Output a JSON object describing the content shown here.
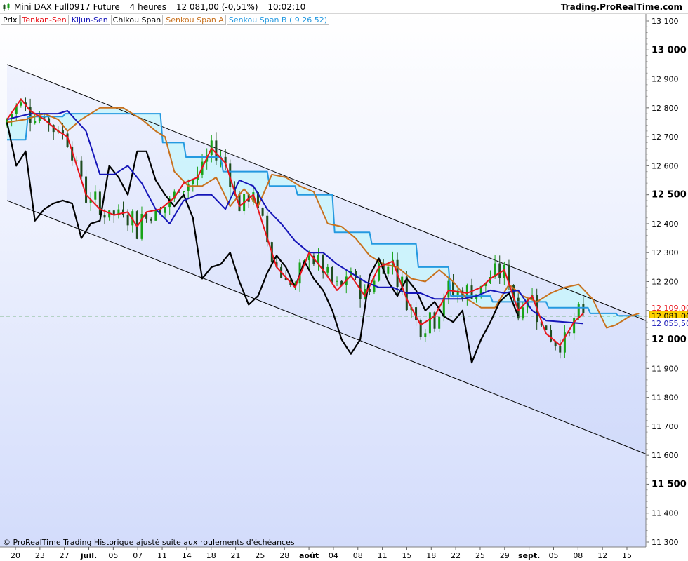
{
  "header": {
    "instrument": "Mini DAX Full0917 Future",
    "timeframe": "4 heures",
    "last_price": "12 081,00 (-0,51%)",
    "time": "10:02:10",
    "brand": "Trading.ProRealTime.com"
  },
  "legend": [
    {
      "label": "Prix",
      "color": "#000000"
    },
    {
      "label": "Tenkan-Sen",
      "color": "#e8141b"
    },
    {
      "label": "Kijun-Sen",
      "color": "#1515b8"
    },
    {
      "label": "Chikou Span",
      "color": "#000000"
    },
    {
      "label": "Senkou Span A",
      "color": "#c8711e"
    },
    {
      "label": "Senkou Span B ( 9 26 52)",
      "color": "#2499e0"
    }
  ],
  "footer": {
    "copyright": "© ProRealTime Trading  Historique ajusté suite aux roulements d'échéances"
  },
  "chart_data": {
    "type": "line",
    "ylim": [
      11300,
      13100
    ],
    "y_ticks": [
      "13 100",
      "13 000",
      "12 900",
      "12 800",
      "12 700",
      "12 600",
      "12 500",
      "12 400",
      "12 300",
      "12 200",
      "12 100",
      "12 000",
      "11 900",
      "11 800",
      "11 700",
      "11 600",
      "11 500",
      "11 400",
      "11 300"
    ],
    "y_major_ticks": [
      "13 000",
      "12 500",
      "12 000",
      "11 500"
    ],
    "x_ticks": [
      "20",
      "23",
      "27",
      "juil.",
      "05",
      "07",
      "11",
      "14",
      "18",
      "21",
      "25",
      "28",
      "août",
      "04",
      "08",
      "11",
      "15",
      "18",
      "22",
      "25",
      "29",
      "sept.",
      "05",
      "08",
      "12",
      "15"
    ],
    "x_major_ticks": [
      "juil.",
      "août",
      "sept."
    ],
    "price_labels": [
      {
        "label": "12 109,00",
        "value": 12109,
        "color": "#e8141b"
      },
      {
        "label": "12 081,00",
        "value": 12081,
        "color": "#000000"
      },
      {
        "label": "12 055,50",
        "value": 12055.5,
        "color": "#1515b8"
      }
    ],
    "current_price": 12081,
    "colors": {
      "candle_up": "#17a317",
      "candle_down": "#1f4d1f",
      "tenkan": "#e8141b",
      "kijun": "#1515b8",
      "chikou": "#000000",
      "span_a": "#c8711e",
      "span_b": "#2499e0",
      "cloud": "#c9f4fb",
      "current_price_line": "#1f8a1f",
      "channel_fill": "#e8edfd"
    },
    "channel": {
      "upper": [
        [
          0,
          12950
        ],
        [
          146,
          12010
        ]
      ],
      "lower": [
        [
          0,
          12480
        ],
        [
          146,
          11550
        ]
      ]
    },
    "series": [
      {
        "name": "Tenkan-Sen",
        "key": "tenkan",
        "points": [
          [
            0,
            12760
          ],
          [
            3,
            12830
          ],
          [
            5,
            12790
          ],
          [
            8,
            12760
          ],
          [
            11,
            12720
          ],
          [
            13,
            12700
          ],
          [
            17,
            12500
          ],
          [
            20,
            12450
          ],
          [
            23,
            12430
          ],
          [
            26,
            12440
          ],
          [
            28,
            12390
          ],
          [
            30,
            12440
          ],
          [
            33,
            12450
          ],
          [
            36,
            12490
          ],
          [
            38,
            12540
          ],
          [
            41,
            12560
          ],
          [
            44,
            12660
          ],
          [
            47,
            12610
          ],
          [
            50,
            12460
          ],
          [
            53,
            12500
          ],
          [
            55,
            12400
          ],
          [
            58,
            12250
          ],
          [
            62,
            12180
          ],
          [
            65,
            12300
          ],
          [
            68,
            12240
          ],
          [
            71,
            12170
          ],
          [
            74,
            12220
          ],
          [
            77,
            12150
          ],
          [
            80,
            12250
          ],
          [
            83,
            12270
          ],
          [
            86,
            12140
          ],
          [
            89,
            12050
          ],
          [
            92,
            12080
          ],
          [
            95,
            12170
          ],
          [
            99,
            12160
          ],
          [
            102,
            12180
          ],
          [
            104,
            12210
          ],
          [
            107,
            12240
          ],
          [
            110,
            12100
          ],
          [
            113,
            12150
          ],
          [
            116,
            12020
          ],
          [
            119,
            11980
          ],
          [
            122,
            12060
          ],
          [
            124,
            12090
          ]
        ]
      },
      {
        "name": "Kijun-Sen",
        "key": "kijun",
        "points": [
          [
            0,
            12760
          ],
          [
            5,
            12780
          ],
          [
            11,
            12780
          ],
          [
            13,
            12790
          ],
          [
            17,
            12720
          ],
          [
            20,
            12570
          ],
          [
            23,
            12570
          ],
          [
            26,
            12600
          ],
          [
            29,
            12540
          ],
          [
            32,
            12450
          ],
          [
            35,
            12400
          ],
          [
            38,
            12480
          ],
          [
            41,
            12500
          ],
          [
            44,
            12500
          ],
          [
            47,
            12450
          ],
          [
            50,
            12550
          ],
          [
            53,
            12530
          ],
          [
            56,
            12450
          ],
          [
            59,
            12400
          ],
          [
            62,
            12340
          ],
          [
            65,
            12300
          ],
          [
            68,
            12300
          ],
          [
            71,
            12260
          ],
          [
            74,
            12230
          ],
          [
            77,
            12200
          ],
          [
            80,
            12180
          ],
          [
            83,
            12180
          ],
          [
            86,
            12160
          ],
          [
            89,
            12160
          ],
          [
            92,
            12140
          ],
          [
            95,
            12140
          ],
          [
            98,
            12140
          ],
          [
            101,
            12150
          ],
          [
            104,
            12170
          ],
          [
            107,
            12160
          ],
          [
            110,
            12170
          ],
          [
            113,
            12100
          ],
          [
            116,
            12065
          ],
          [
            120,
            12060
          ],
          [
            124,
            12055
          ]
        ]
      },
      {
        "name": "Chikou Span",
        "key": "chikou",
        "points": [
          [
            0,
            12750
          ],
          [
            2,
            12600
          ],
          [
            4,
            12650
          ],
          [
            6,
            12410
          ],
          [
            8,
            12450
          ],
          [
            10,
            12470
          ],
          [
            12,
            12480
          ],
          [
            14,
            12470
          ],
          [
            16,
            12350
          ],
          [
            18,
            12400
          ],
          [
            20,
            12410
          ],
          [
            22,
            12600
          ],
          [
            24,
            12560
          ],
          [
            26,
            12500
          ],
          [
            28,
            12650
          ],
          [
            30,
            12650
          ],
          [
            32,
            12550
          ],
          [
            34,
            12500
          ],
          [
            36,
            12460
          ],
          [
            38,
            12500
          ],
          [
            40,
            12420
          ],
          [
            42,
            12210
          ],
          [
            44,
            12250
          ],
          [
            46,
            12260
          ],
          [
            48,
            12300
          ],
          [
            50,
            12200
          ],
          [
            52,
            12120
          ],
          [
            54,
            12150
          ],
          [
            56,
            12230
          ],
          [
            58,
            12290
          ],
          [
            60,
            12250
          ],
          [
            62,
            12180
          ],
          [
            64,
            12270
          ],
          [
            66,
            12210
          ],
          [
            68,
            12170
          ],
          [
            70,
            12100
          ],
          [
            72,
            12000
          ],
          [
            74,
            11950
          ],
          [
            76,
            12000
          ],
          [
            78,
            12220
          ],
          [
            80,
            12280
          ],
          [
            82,
            12200
          ],
          [
            84,
            12150
          ],
          [
            86,
            12210
          ],
          [
            88,
            12170
          ],
          [
            90,
            12100
          ],
          [
            92,
            12130
          ],
          [
            94,
            12080
          ],
          [
            96,
            12060
          ],
          [
            98,
            12100
          ],
          [
            100,
            11920
          ],
          [
            102,
            12000
          ],
          [
            104,
            12060
          ],
          [
            106,
            12130
          ],
          [
            108,
            12160
          ],
          [
            110,
            12080
          ]
        ]
      },
      {
        "name": "Senkou Span A",
        "key": "span_a",
        "points": [
          [
            0,
            12750
          ],
          [
            4,
            12760
          ],
          [
            8,
            12780
          ],
          [
            11,
            12760
          ],
          [
            13,
            12720
          ],
          [
            16,
            12760
          ],
          [
            20,
            12800
          ],
          [
            25,
            12800
          ],
          [
            29,
            12760
          ],
          [
            32,
            12720
          ],
          [
            34,
            12700
          ],
          [
            36,
            12580
          ],
          [
            39,
            12530
          ],
          [
            42,
            12530
          ],
          [
            45,
            12560
          ],
          [
            48,
            12460
          ],
          [
            51,
            12520
          ],
          [
            54,
            12460
          ],
          [
            57,
            12570
          ],
          [
            60,
            12560
          ],
          [
            63,
            12530
          ],
          [
            66,
            12510
          ],
          [
            69,
            12400
          ],
          [
            72,
            12390
          ],
          [
            75,
            12350
          ],
          [
            78,
            12290
          ],
          [
            81,
            12260
          ],
          [
            84,
            12250
          ],
          [
            87,
            12210
          ],
          [
            90,
            12200
          ],
          [
            93,
            12240
          ],
          [
            96,
            12200
          ],
          [
            99,
            12140
          ],
          [
            102,
            12110
          ],
          [
            105,
            12110
          ],
          [
            108,
            12190
          ],
          [
            111,
            12150
          ],
          [
            114,
            12130
          ],
          [
            117,
            12160
          ],
          [
            120,
            12180
          ],
          [
            123,
            12190
          ],
          [
            126,
            12140
          ],
          [
            129,
            12040
          ],
          [
            131,
            12050
          ],
          [
            134,
            12080
          ],
          [
            136,
            12090
          ]
        ]
      },
      {
        "name": "Senkou Span B ( 9 26 52)",
        "key": "span_b",
        "points": [
          [
            0,
            12690
          ],
          [
            4,
            12690
          ],
          [
            4.5,
            12770
          ],
          [
            12,
            12770
          ],
          [
            12.5,
            12780
          ],
          [
            20,
            12780
          ],
          [
            20.5,
            12780
          ],
          [
            33,
            12780
          ],
          [
            33.5,
            12680
          ],
          [
            38,
            12680
          ],
          [
            38.5,
            12630
          ],
          [
            46,
            12630
          ],
          [
            46.5,
            12580
          ],
          [
            56,
            12580
          ],
          [
            56.5,
            12530
          ],
          [
            62,
            12530
          ],
          [
            62.5,
            12500
          ],
          [
            70,
            12500
          ],
          [
            70.5,
            12370
          ],
          [
            78,
            12370
          ],
          [
            78.5,
            12330
          ],
          [
            88,
            12330
          ],
          [
            88.5,
            12250
          ],
          [
            95,
            12250
          ],
          [
            95.5,
            12150
          ],
          [
            104,
            12150
          ],
          [
            104.5,
            12130
          ],
          [
            116,
            12130
          ],
          [
            116.5,
            12110
          ],
          [
            125,
            12110
          ],
          [
            125.5,
            12090
          ],
          [
            131,
            12090
          ],
          [
            131.5,
            12082
          ],
          [
            136,
            12082
          ]
        ]
      }
    ]
  }
}
